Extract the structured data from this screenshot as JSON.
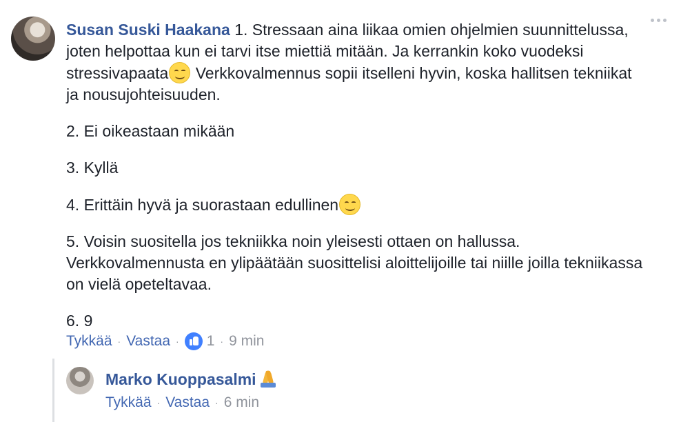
{
  "comment": {
    "author": "Susan Suski Haakana",
    "paragraphs": {
      "p1_a": "1. Stressaan aina liikaa omien ohjelmien suunnittelussa, joten helpottaa kun ei tarvi itse miettiä mitään. Ja kerrankin koko vuodeksi stressivapaata",
      "p1_b": " Verkkovalmennus sopii itselleni hyvin, koska hallitsen tekniikat ja nousujohteisuuden.",
      "p2": "2. Ei oikeastaan mikään",
      "p3": "3. Kyllä",
      "p4": "4. Erittäin hyvä ja suorastaan edullinen",
      "p5": "5. Voisin suositella jos tekniikka noin yleisesti ottaen on hallussa. Verkkovalmennusta en ylipäätään suosittelisi aloittelijoille tai niille joilla tekniikassa on vielä opeteltavaa.",
      "p6": "6. 9"
    },
    "actions": {
      "like": "Tykkää",
      "reply": "Vastaa",
      "like_count": "1",
      "time": "9 min"
    },
    "emoji_icons": [
      "smiling-face-icon",
      "like-thumb-icon"
    ]
  },
  "reply": {
    "author": "Marko Kuoppasalmi",
    "actions": {
      "like": "Tykkää",
      "reply": "Vastaa",
      "time": "6 min"
    },
    "emoji_icons": [
      "praying-hands-icon"
    ]
  },
  "colors": {
    "author_link": "#365899",
    "action_link": "#4267b2",
    "muted": "#90949c",
    "like_badge": "#4080ff"
  }
}
